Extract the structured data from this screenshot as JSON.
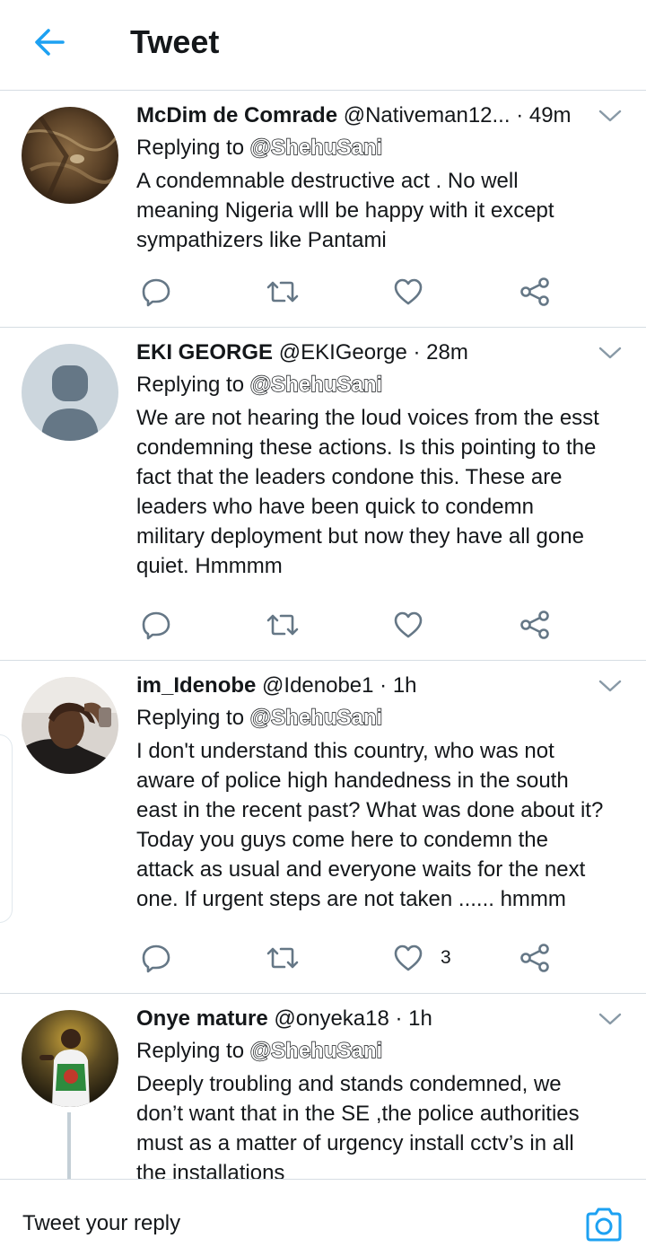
{
  "header": {
    "title": "Tweet",
    "back_icon": "arrow-left-icon",
    "accent": "#1da1f2"
  },
  "tweets": [
    {
      "name": "McDim de Comrade",
      "handle": "@Nativeman12...",
      "time": "· 49m",
      "replying_label": "Replying to",
      "mention": "@ShehuSani",
      "text": "A condemnable destructive act . No well\nmeaning Nigeria wlll be happy with it except\nsympathizers like Pantami",
      "likes": ""
    },
    {
      "name": "EKI GEORGE",
      "handle": "@EKIGeorge",
      "time": "· 28m",
      "replying_label": "Replying to",
      "mention": "@ShehuSani",
      "text": "We are not hearing the loud voices from the esst\ncondemning these actions. Is this pointing to the\nfact that the leaders condone this. These are\nleaders who have been quick to condemn\nmilitary deployment but now they have all gone\nquiet. Hmmmm",
      "likes": ""
    },
    {
      "name": "im_Idenobe",
      "handle": "@Idenobe1",
      "time": "· 1h",
      "replying_label": "Replying to",
      "mention": "@ShehuSani",
      "text": "I don't understand this country, who was not\naware of police high handedness in the south\neast in the recent past? What was done about it?\nToday you guys come here to condemn the\nattack as usual and everyone waits for the next\none. If urgent steps are not taken ...... hmmm",
      "likes": "3"
    },
    {
      "name": "Onye mature",
      "handle": "@onyeka18",
      "time": "· 1h",
      "replying_label": "Replying to",
      "mention": "@ShehuSani",
      "text": "Deeply troubling and stands condemned, we\ndon’t want that in the SE ,the police authorities\nmust as a matter of urgency install cctv’s in all\nthe installations",
      "likes": ""
    }
  ],
  "action_icons": [
    "reply-icon",
    "retweet-icon",
    "like-icon",
    "share-icon"
  ],
  "composer": {
    "placeholder": "Tweet your reply",
    "camera_icon": "camera-icon"
  }
}
